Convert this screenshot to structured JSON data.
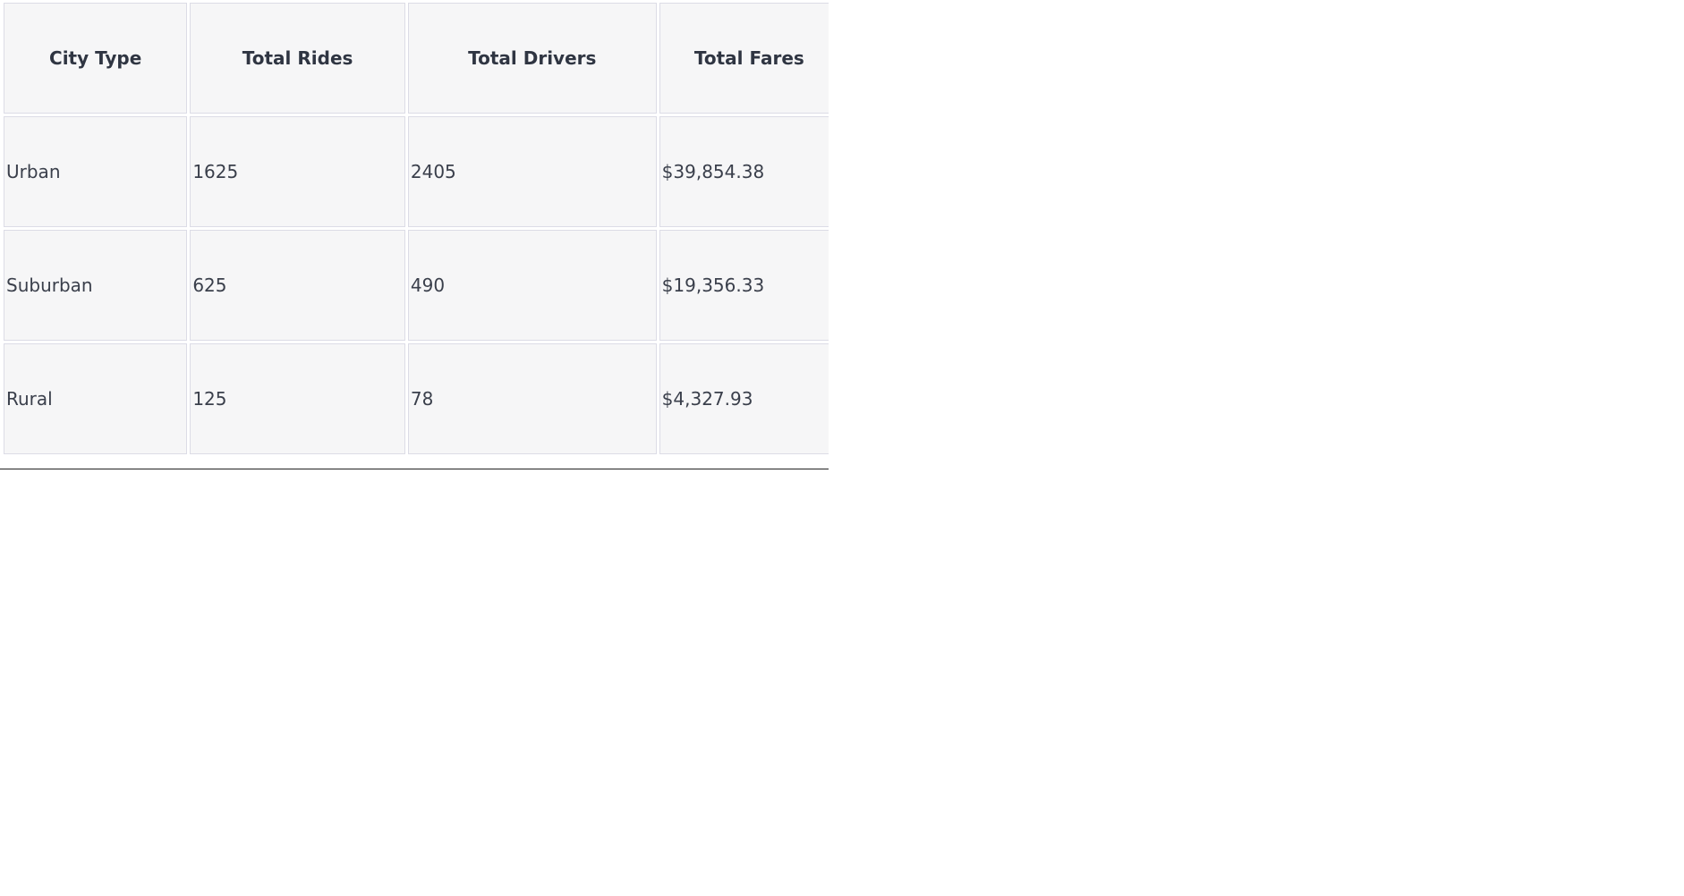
{
  "table": {
    "headers": [
      "City Type",
      "Total Rides",
      "Total Drivers",
      "Total Fares"
    ],
    "rows": [
      [
        "Urban",
        "1625",
        "2405",
        "$39,854.38"
      ],
      [
        "Suburban",
        "625",
        "490",
        "$19,356.33"
      ],
      [
        "Rural",
        "125",
        "78",
        "$4,327.93"
      ]
    ]
  }
}
